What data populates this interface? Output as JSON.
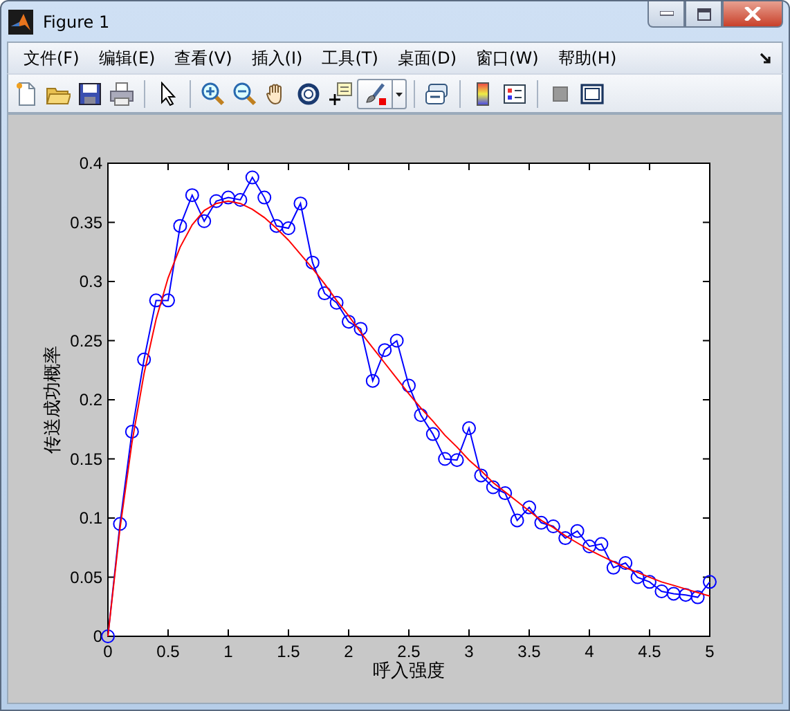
{
  "window": {
    "title": "Figure 1"
  },
  "menu": [
    "文件(F)",
    "编辑(E)",
    "查看(V)",
    "插入(I)",
    "工具(T)",
    "桌面(D)",
    "窗口(W)",
    "帮助(H)"
  ],
  "plot": {
    "chart_data": {
      "type": "line",
      "xlabel": "呼入强度",
      "ylabel": "传送成功概率",
      "x": [
        0,
        0.1,
        0.2,
        0.3,
        0.4,
        0.5,
        0.6,
        0.7,
        0.8,
        0.9,
        1,
        1.1,
        1.2,
        1.3,
        1.4,
        1.5,
        1.6,
        1.7,
        1.8,
        1.9,
        2,
        2.1,
        2.2,
        2.3,
        2.4,
        2.5,
        2.6,
        2.7,
        2.8,
        2.9,
        3,
        3.1,
        3.2,
        3.3,
        3.4,
        3.5,
        3.6,
        3.7,
        3.8,
        3.9,
        4,
        4.1,
        4.2,
        4.3,
        4.4,
        4.5,
        4.6,
        4.7,
        4.8,
        4.9,
        5
      ],
      "xlim": [
        0,
        5
      ],
      "ylim": [
        0,
        0.4
      ],
      "xticks": [
        0,
        0.5,
        1,
        1.5,
        2,
        2.5,
        3,
        3.5,
        4,
        4.5,
        5
      ],
      "yticks": [
        0,
        0.05,
        0.1,
        0.15,
        0.2,
        0.25,
        0.3,
        0.35,
        0.4
      ],
      "series": [
        {
          "color": "#0000ff",
          "marker": "circle",
          "values": [
            0,
            0.095,
            0.173,
            0.234,
            0.284,
            0.284,
            0.347,
            0.373,
            0.351,
            0.368,
            0.371,
            0.369,
            0.388,
            0.371,
            0.347,
            0.345,
            0.366,
            0.316,
            0.29,
            0.282,
            0.266,
            0.26,
            0.216,
            0.242,
            0.25,
            0.212,
            0.187,
            0.171,
            0.15,
            0.149,
            0.176,
            0.136,
            0.126,
            0.121,
            0.098,
            0.109,
            0.096,
            0.093,
            0.083,
            0.089,
            0.076,
            0.078,
            0.058,
            0.062,
            0.05,
            0.046,
            0.038,
            0.036,
            0.035,
            0.033,
            0.046
          ]
        },
        {
          "color": "#ff0000",
          "marker": "none",
          "values": [
            0,
            0.091,
            0.164,
            0.222,
            0.268,
            0.303,
            0.329,
            0.348,
            0.36,
            0.366,
            0.368,
            0.366,
            0.361,
            0.354,
            0.345,
            0.335,
            0.323,
            0.311,
            0.298,
            0.284,
            0.271,
            0.257,
            0.244,
            0.231,
            0.218,
            0.205,
            0.193,
            0.182,
            0.17,
            0.16,
            0.149,
            0.14,
            0.13,
            0.122,
            0.114,
            0.106,
            0.098,
            0.092,
            0.085,
            0.079,
            0.073,
            0.068,
            0.063,
            0.058,
            0.054,
            0.05,
            0.046,
            0.043,
            0.04,
            0.037,
            0.034
          ]
        }
      ]
    }
  }
}
